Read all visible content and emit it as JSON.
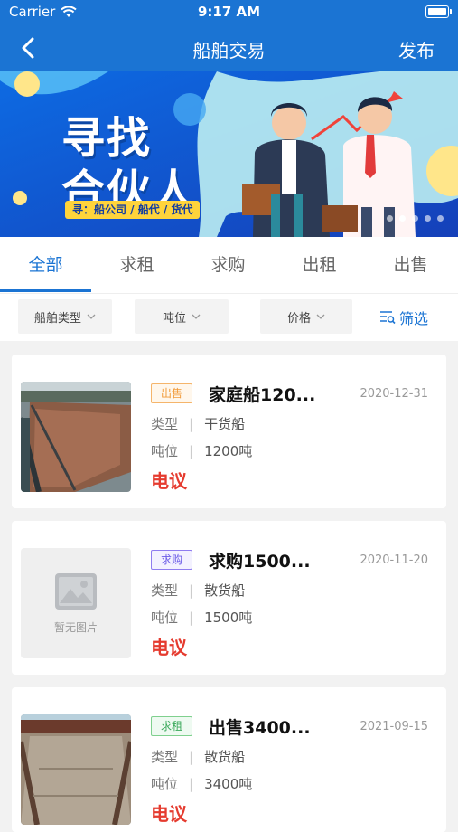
{
  "status_bar": {
    "carrier": "Carrier",
    "time": "9:17 AM"
  },
  "nav": {
    "title": "船舶交易",
    "publish_label": "发布"
  },
  "banner": {
    "line1": "寻找",
    "line2": "合伙人",
    "subtitle": "寻：船公司 / 船代 / 货代",
    "slide_count": 5,
    "active_slide": 2
  },
  "tabs": [
    "全部",
    "求租",
    "求购",
    "出租",
    "出售"
  ],
  "filters": {
    "ship_type": "船舶类型",
    "tonnage": "吨位",
    "price": "价格",
    "screen": "筛选"
  },
  "listings": [
    {
      "tag": "出售",
      "tag_type": "sale",
      "title": "家庭船120...",
      "date": "2020-12-31",
      "type_label": "类型",
      "type": "干货船",
      "tonnage_label": "吨位",
      "tonnage": "1200吨",
      "price": "电议",
      "has_image": true
    },
    {
      "tag": "求购",
      "tag_type": "buy",
      "title": "求购1500...",
      "date": "2020-11-20",
      "type_label": "类型",
      "type": "散货船",
      "tonnage_label": "吨位",
      "tonnage": "1500吨",
      "price": "电议",
      "has_image": false,
      "no_image_text": "暂无图片"
    },
    {
      "tag": "求租",
      "tag_type": "rent",
      "title": "出售3400...",
      "date": "2021-09-15",
      "type_label": "类型",
      "type": "散货船",
      "tonnage_label": "吨位",
      "tonnage": "3400吨",
      "price": "电议",
      "has_image": true
    }
  ],
  "colors": {
    "primary": "#1b74d3",
    "price": "#e53b2f"
  }
}
